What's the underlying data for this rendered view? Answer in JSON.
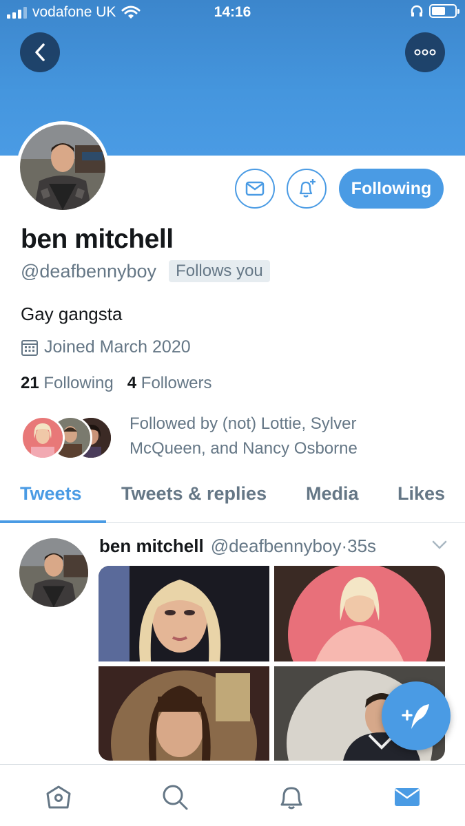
{
  "status_bar": {
    "carrier": "vodafone UK",
    "time": "14:16",
    "battery_level": 0.6
  },
  "header": {
    "back_icon": "chevron-left-icon",
    "more_icon": "more-horizontal-icon"
  },
  "profile": {
    "name": "ben mitchell",
    "handle": "@deafbennyboy",
    "follows_you": "Follows you",
    "bio": "Gay gangsta",
    "joined": "Joined March 2020",
    "following_count": "21",
    "following_label": "Following",
    "followers_count": "4",
    "followers_label": "Followers",
    "followed_by": "Followed by (not) Lottie, Sylver McQueen, and Nancy Osborne"
  },
  "actions": {
    "following_button": "Following",
    "message_icon": "mail-icon",
    "notify_icon": "bell-plus-icon"
  },
  "tabs": [
    {
      "label": "Tweets",
      "active": true
    },
    {
      "label": "Tweets & replies",
      "active": false
    },
    {
      "label": "Media",
      "active": false
    },
    {
      "label": "Likes",
      "active": false
    }
  ],
  "tweet": {
    "name": "ben mitchell",
    "handle": "@deafbennyboy",
    "separator": "·",
    "time": "35s"
  },
  "bottom_nav": [
    "home-icon",
    "search-icon",
    "bell-icon",
    "mail-icon"
  ],
  "colors": {
    "accent": "#4a9be4",
    "text_secondary": "#657786",
    "banner": "#4596de"
  }
}
